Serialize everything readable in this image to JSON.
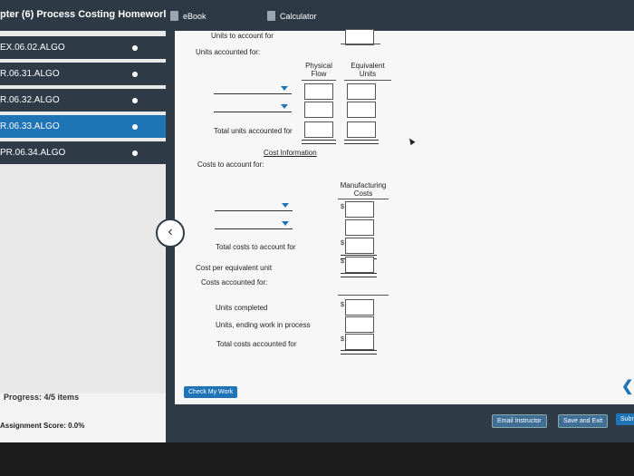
{
  "header": {
    "course_title": "pter (6) Process Costing Homeworl",
    "ebook_label": "eBook",
    "calculator_label": "Calculator"
  },
  "sidebar": {
    "items": [
      {
        "label": "EX.06.02.ALGO",
        "active": false
      },
      {
        "label": "R.06.31.ALGO",
        "active": false
      },
      {
        "label": "R.06.32.ALGO",
        "active": false
      },
      {
        "label": "R.06.33.ALGO",
        "active": true
      },
      {
        "label": "PR.06.34.ALGO",
        "active": false
      }
    ],
    "progress_label": "Progress:",
    "progress_value": "4/5 items",
    "score_label": "Assignment Score: 0.0%"
  },
  "form": {
    "units_to_account_for": "Units to account for",
    "units_accounted_for": "Units accounted for:",
    "col_physical_flow": "Physical Flow",
    "col_equivalent_units": "Equivalent Units",
    "total_units_accounted_for": "Total units accounted for",
    "cost_information": "Cost Information",
    "costs_to_account_for": "Costs to account for:",
    "col_manufacturing_costs": "Manufacturing Costs",
    "total_costs_to_account_for": "Total costs to account for",
    "cost_per_equivalent_unit": "Cost per equivalent unit",
    "costs_accounted_for": "Costs accounted for:",
    "units_completed": "Units completed",
    "units_ending_wip": "Units, ending work in process",
    "total_costs_accounted_for": "Total costs accounted for",
    "currency_symbol": "$"
  },
  "buttons": {
    "check_my_work": "Check My Work",
    "email_instructor": "Email Instructor",
    "save_and_exit": "Save and Exit",
    "submit": "Subm"
  },
  "icons": {
    "back": "chevron-left-icon",
    "next": "chevron-left-icon",
    "ebook": "book-icon",
    "calculator": "calculator-icon"
  },
  "colors": {
    "nav_dark": "#2f3c48",
    "accent_blue": "#1f74b6"
  }
}
